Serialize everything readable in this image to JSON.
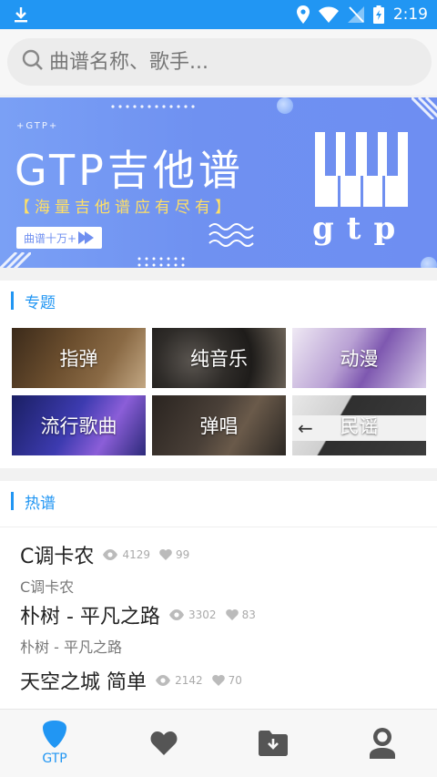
{
  "status_bar": {
    "time": "2:19"
  },
  "search": {
    "placeholder": "曲谱名称、歌手..."
  },
  "banner": {
    "sub": "+GTP+",
    "title": "GTP吉他谱",
    "tagline": "【海量吉他谱应有尽有】",
    "button": "曲谱十万+",
    "logo_text": "gtp"
  },
  "topics": {
    "header": "专题",
    "items": [
      {
        "label": "指弹"
      },
      {
        "label": "纯音乐"
      },
      {
        "label": "动漫"
      },
      {
        "label": "流行歌曲"
      },
      {
        "label": "弹唱"
      },
      {
        "label": "民谣"
      }
    ]
  },
  "hot": {
    "header": "热谱",
    "songs": [
      {
        "name": "C调卡农",
        "views": "4129",
        "likes": "99",
        "artist": "C调卡农"
      },
      {
        "name": "朴树 - 平凡之路",
        "views": "3302",
        "likes": "83",
        "artist": "朴树 - 平凡之路"
      },
      {
        "name": "天空之城 简单",
        "views": "2142",
        "likes": "70",
        "artist": ""
      }
    ]
  },
  "nav": {
    "items": [
      {
        "label": "GTP",
        "icon": "pick-icon",
        "active": true
      },
      {
        "label": "",
        "icon": "heart-icon"
      },
      {
        "label": "",
        "icon": "download-folder-icon"
      },
      {
        "label": "",
        "icon": "user-icon"
      }
    ],
    "active_color": "#2196f3",
    "inactive_color": "#555555"
  },
  "colors": {
    "accent": "#2196f3"
  }
}
